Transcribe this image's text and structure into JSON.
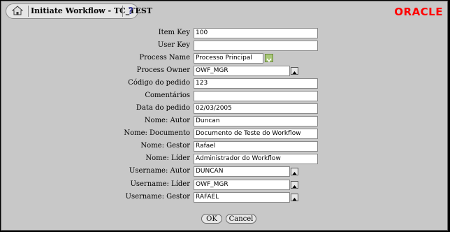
{
  "window": {
    "title": "Initiate Workflow - TC_TEST",
    "help_label": "?",
    "logo": "ORACLE"
  },
  "fields": [
    {
      "label": "Item Key",
      "value": "100"
    },
    {
      "label": "User Key",
      "value": ""
    },
    {
      "label": "Process Name",
      "value": "Processo Principal"
    },
    {
      "label": "Process Owner",
      "value": "OWF_MGR"
    },
    {
      "label": "Código do pedido",
      "value": "123"
    },
    {
      "label": "Comentários",
      "value": ""
    },
    {
      "label": "Data do pedido",
      "value": "02/03/2005"
    },
    {
      "label": "Nome: Autor",
      "value": "Duncan"
    },
    {
      "label": "Nome: Documento",
      "value": "Documento de Teste do Workflow"
    },
    {
      "label": "Nome: Gestor",
      "value": "Rafael"
    },
    {
      "label": "Nome: Líder",
      "value": "Administrador do Workflow"
    },
    {
      "label": "Username: Autor",
      "value": "DUNCAN"
    },
    {
      "label": "Username: Líder",
      "value": "OWF_MGR"
    },
    {
      "label": "Username: Gestor",
      "value": "RAFAEL"
    }
  ],
  "buttons": {
    "ok": "OK",
    "cancel": "Cancel"
  },
  "colors": {
    "background": "#c8c8c8",
    "logo": "#ff0000",
    "select_arrow": "#a9c77a"
  }
}
